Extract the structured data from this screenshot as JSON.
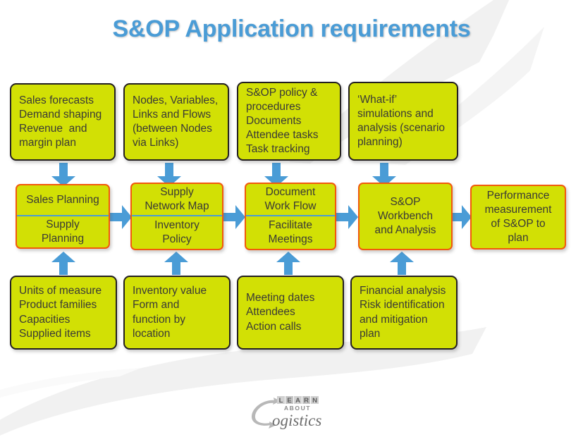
{
  "title": "S&OP Application requirements",
  "colors": {
    "title": "#4a9cd6",
    "box_fill": "#d2e005",
    "box_border_outer": "#231f20",
    "box_border_process": "#f2590c",
    "divider": "#4a9cd6",
    "arrow": "#4a9cd6",
    "text": "#3a3a36",
    "background": "#ffffff",
    "watermark": "#f0f0f0"
  },
  "top_row": [
    {
      "name": "sales-forecast-inputs",
      "lines": [
        "Sales forecasts",
        "Demand shaping",
        "Revenue  and",
        "margin plan"
      ]
    },
    {
      "name": "network-inputs",
      "lines": [
        "Nodes, Variables,",
        "Links and Flows",
        "(between Nodes",
        "via Links)"
      ]
    },
    {
      "name": "policy-inputs",
      "lines": [
        "S&OP policy &",
        "procedures",
        "Documents",
        "Attendee tasks",
        "Task tracking"
      ]
    },
    {
      "name": "whatif-inputs",
      "lines": [
        "‘What-if’",
        "simulations and",
        "analysis (scenario",
        "planning)"
      ]
    }
  ],
  "middle_row": [
    {
      "name": "sales-supply-planning",
      "split": true,
      "top": [
        "Sales Planning"
      ],
      "bottom": [
        "Supply",
        "Planning"
      ]
    },
    {
      "name": "supply-network-inventory",
      "split": true,
      "top": [
        "Supply",
        "Network Map"
      ],
      "bottom": [
        "Inventory",
        "Policy"
      ]
    },
    {
      "name": "document-workflow-meetings",
      "split": true,
      "top": [
        "Document",
        "Work Flow"
      ],
      "bottom": [
        "Facilitate",
        "Meetings"
      ]
    },
    {
      "name": "sop-workbench",
      "split": false,
      "lines": [
        "S&OP",
        "Workbench",
        "and Analysis"
      ]
    },
    {
      "name": "performance-measurement",
      "split": false,
      "lines": [
        "Performance",
        "measurement",
        "of S&OP to",
        "plan"
      ]
    }
  ],
  "bottom_row": [
    {
      "name": "measure-data-inputs",
      "lines": [
        "Units of measure",
        "Product families",
        "Capacities",
        "Supplied items"
      ]
    },
    {
      "name": "inventory-data-inputs",
      "lines": [
        "Inventory value",
        "Form and",
        "function by",
        "location"
      ]
    },
    {
      "name": "meeting-data-inputs",
      "lines": [
        "Meeting dates",
        "Attendees",
        "Action calls"
      ]
    },
    {
      "name": "financial-data-inputs",
      "lines": [
        "Financial analysis",
        "Risk identification",
        "and mitigation",
        "plan"
      ]
    }
  ],
  "logo": {
    "word_learn": "LEARN",
    "word_about": "ABOUT",
    "word_main": "ogistics"
  }
}
